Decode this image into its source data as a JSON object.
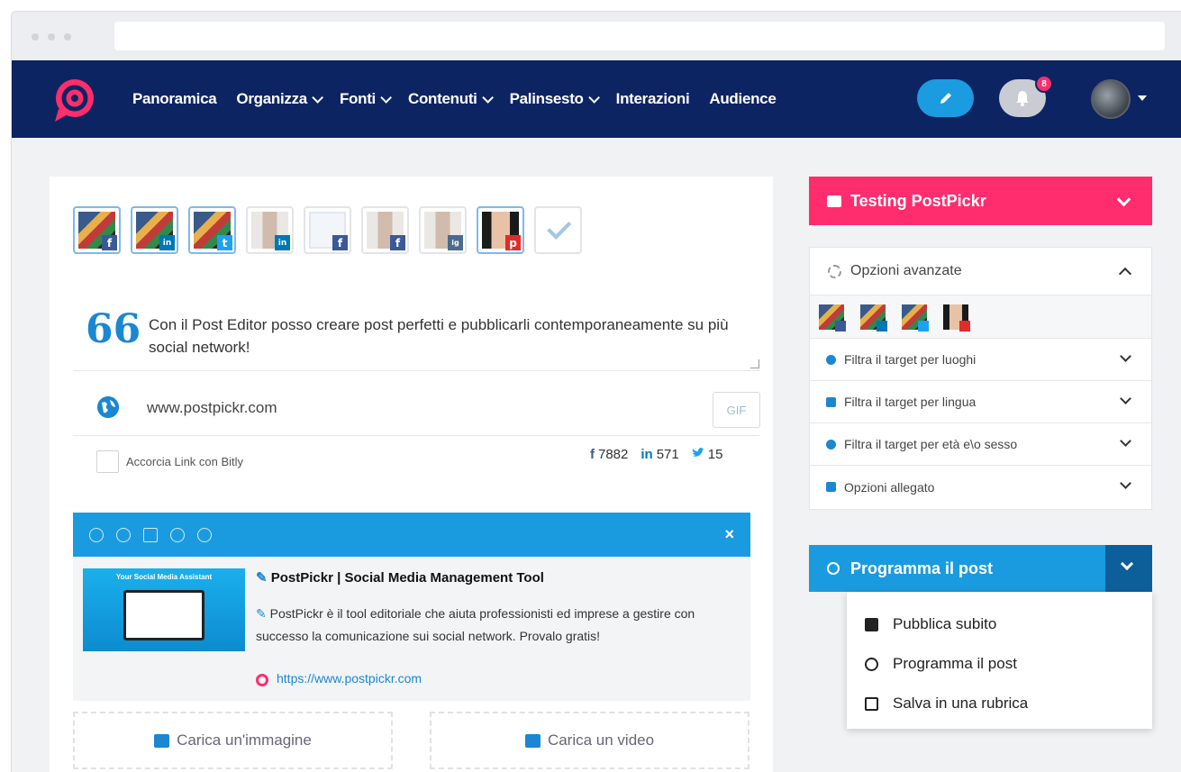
{
  "nav": {
    "items": [
      {
        "label": "Panoramica",
        "has_dropdown": false
      },
      {
        "label": "Organizza",
        "has_dropdown": true
      },
      {
        "label": "Fonti",
        "has_dropdown": true
      },
      {
        "label": "Contenuti",
        "has_dropdown": true
      },
      {
        "label": "Palinsesto",
        "has_dropdown": true
      },
      {
        "label": "Interazioni",
        "has_dropdown": false
      },
      {
        "label": "Audience",
        "has_dropdown": false
      }
    ],
    "notification_count": "8",
    "colors": {
      "bar": "#0d2463",
      "compose": "#1b9be0",
      "badge": "#ff2e6b"
    }
  },
  "editor": {
    "profiles": [
      {
        "network": "facebook",
        "badge": "f",
        "selected": true
      },
      {
        "network": "linkedin",
        "badge": "in",
        "selected": true
      },
      {
        "network": "twitter",
        "badge": "t",
        "selected": true
      },
      {
        "network": "linkedin",
        "badge": "in",
        "selected": false
      },
      {
        "network": "facebook",
        "badge": "f",
        "selected": false
      },
      {
        "network": "facebook",
        "badge": "f",
        "selected": false
      },
      {
        "network": "instagram",
        "badge": "ig",
        "selected": false
      },
      {
        "network": "pinterest",
        "badge": "p",
        "selected": true
      }
    ],
    "quote_mark": "66",
    "post_text": "Con il Post Editor posso creare post perfetti e pubblicarli contemporaneamente su più social network!",
    "link": "www.postpickr.com",
    "gif_label": "GIF",
    "shorten_label": "Accorcia Link con Bitly",
    "counts": [
      {
        "network": "facebook",
        "icon": "f",
        "value": "7882"
      },
      {
        "network": "linkedin",
        "icon": "in",
        "value": "571"
      },
      {
        "network": "twitter",
        "icon": "twitter-bird",
        "value": "15"
      }
    ]
  },
  "preview": {
    "image_caption": "Your Social Media Assistant",
    "title": "PostPickr | Social Media Management Tool",
    "description": "PostPickr è il tool editoriale che aiuta professionisti ed imprese a gestire con successo la comunicazione sui social network. Provalo gratis!",
    "url": "https://www.postpickr.com",
    "close": "×"
  },
  "uploads": {
    "image_label": "Carica un'immagine",
    "video_label": "Carica un video"
  },
  "sidebar": {
    "account_label": "Testing PostPickr",
    "advanced_label": "Opzioni avanzate",
    "options": [
      "Filtra il target per luoghi",
      "Filtra il target per lingua",
      "Filtra il target per età e\\o sesso",
      "Opzioni allegato"
    ],
    "schedule_label": "Programma il post",
    "menu": [
      {
        "label": "Pubblica subito",
        "icon": "upload-icon"
      },
      {
        "label": "Programma il post",
        "icon": "clock-icon"
      },
      {
        "label": "Salva in una rubrica",
        "icon": "box-icon"
      }
    ],
    "colors": {
      "account": "#ff2d6e",
      "schedule": "#1a9be0"
    }
  }
}
